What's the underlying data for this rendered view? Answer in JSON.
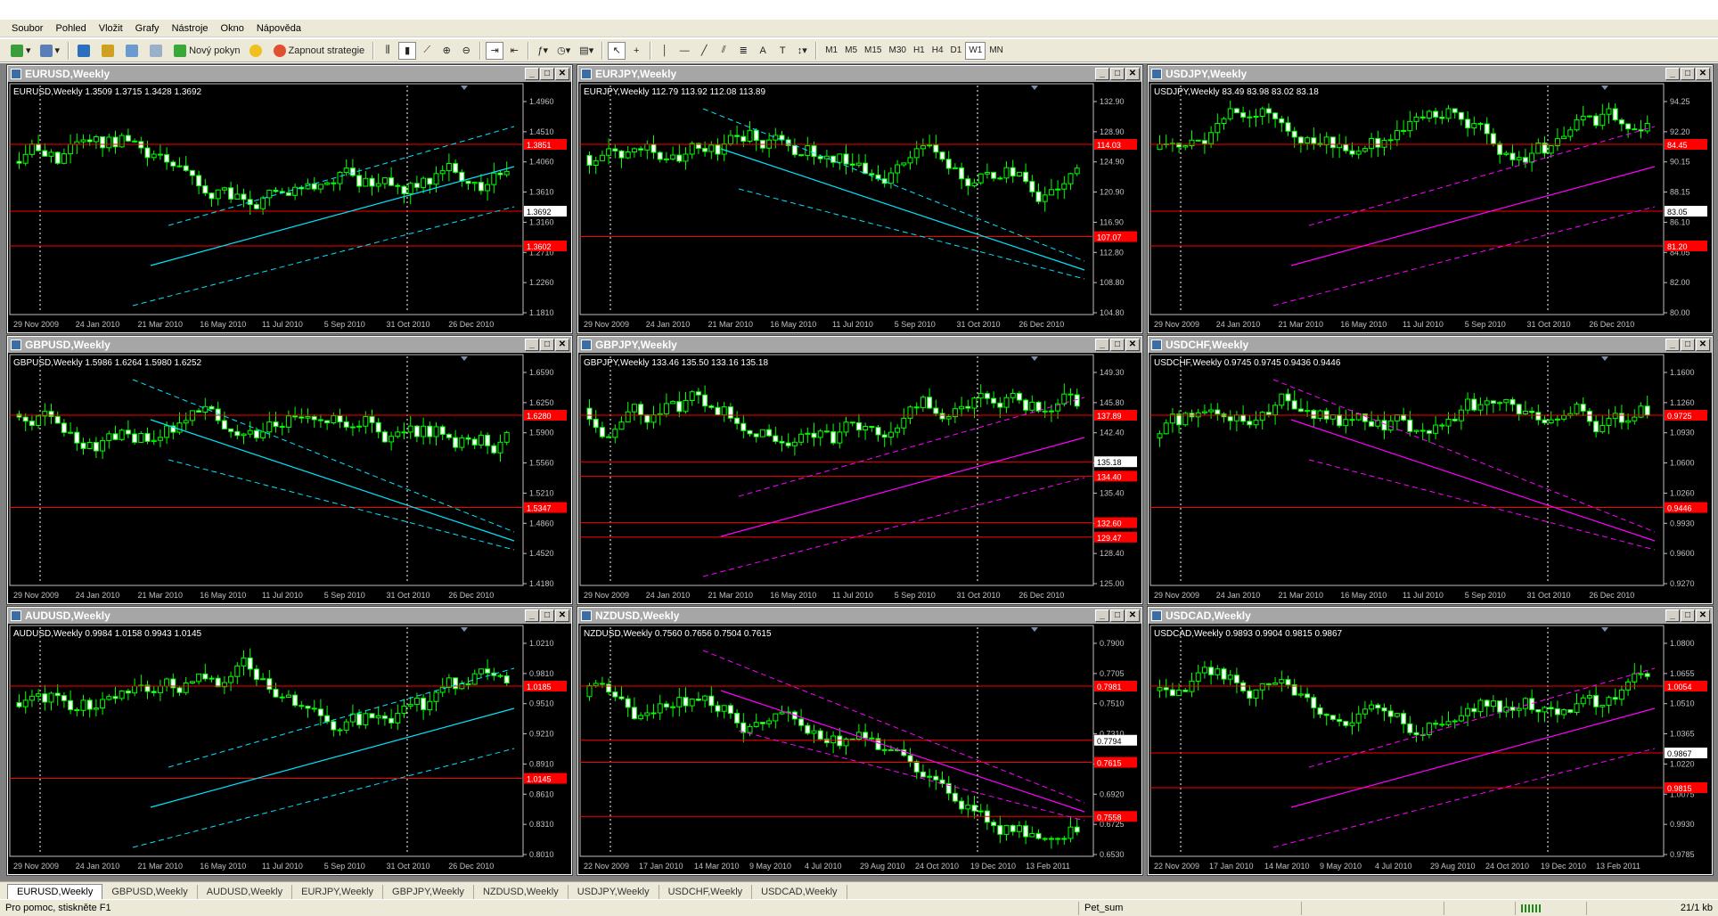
{
  "menu": [
    "Soubor",
    "Pohled",
    "Vložit",
    "Grafy",
    "Nástroje",
    "Okno",
    "Nápověda"
  ],
  "toolbar": {
    "new_order": "Nový pokyn",
    "strategies": "Zapnout strategie",
    "text_tool": "A",
    "timeframes": [
      "M1",
      "M5",
      "M15",
      "M30",
      "H1",
      "H4",
      "D1",
      "W1",
      "MN"
    ],
    "active_timeframe": "W1"
  },
  "colors": {
    "bull": "#00ff00",
    "bear": "#ffffff",
    "line": "#ff0000",
    "channel": "#00e5ff",
    "magenta": "#ff00ff",
    "grid": "#c0c0c0"
  },
  "charts": [
    {
      "id": "eurusd",
      "title": "EURUSD,Weekly",
      "info": "EURUSD,Weekly  1.3509 1.3715 1.3428 1.3692",
      "prices": [
        "1.4960",
        "1.4510",
        "1.4060",
        "1.3610",
        "1.3160",
        "1.2710",
        "1.2260",
        "1.1810"
      ],
      "dates": [
        "29 Nov 2009",
        "24 Jan 2010",
        "21 Mar 2010",
        "16 May 2010",
        "11 Jul 2010",
        "5 Sep 2010",
        "31 Oct 2010",
        "26 Dec 2010"
      ],
      "tags": [
        "1.3851",
        "1.3692",
        "1.3602"
      ],
      "ovl": "cyan"
    },
    {
      "id": "eurjpy",
      "title": "EURJPY,Weekly",
      "info": "EURJPY,Weekly  112.79 113.92 112.08 113.89",
      "prices": [
        "132.90",
        "128.90",
        "124.90",
        "120.90",
        "116.90",
        "112.80",
        "108.80",
        "104.80"
      ],
      "dates": [
        "29 Nov 2009",
        "24 Jan 2010",
        "21 Mar 2010",
        "16 May 2010",
        "11 Jul 2010",
        "5 Sep 2010",
        "31 Oct 2010",
        "26 Dec 2010"
      ],
      "tags": [
        "114.03",
        "107.07"
      ],
      "ovl": "cyan"
    },
    {
      "id": "usdjpy",
      "title": "USDJPY,Weekly",
      "info": "USDJPY,Weekly  83.49 83.98 83.02 83.18",
      "prices": [
        "94.25",
        "92.20",
        "90.15",
        "88.15",
        "86.10",
        "84.05",
        "82.00",
        "80.00"
      ],
      "dates": [
        "29 Nov 2009",
        "24 Jan 2010",
        "21 Mar 2010",
        "16 May 2010",
        "11 Jul 2010",
        "5 Sep 2010",
        "31 Oct 2010",
        "26 Dec 2010"
      ],
      "tags": [
        "84.45",
        "83.05",
        "81.20"
      ],
      "ovl": "magenta"
    },
    {
      "id": "gbpusd",
      "title": "GBPUSD,Weekly",
      "info": "GBPUSD,Weekly  1.5986 1.6264 1.5980 1.6252",
      "prices": [
        "1.6590",
        "1.6250",
        "1.5900",
        "1.5560",
        "1.5210",
        "1.4860",
        "1.4520",
        "1.4180"
      ],
      "dates": [
        "29 Nov 2009",
        "24 Jan 2010",
        "21 Mar 2010",
        "16 May 2010",
        "11 Jul 2010",
        "5 Sep 2010",
        "31 Oct 2010",
        "26 Dec 2010"
      ],
      "tags": [
        "1.6280",
        "1.5347"
      ],
      "ovl": "cyan"
    },
    {
      "id": "gbpjpy",
      "title": "GBPJPY,Weekly",
      "info": "GBPJPY,Weekly  133.46 135.50 133.16 135.18",
      "prices": [
        "149.30",
        "145.80",
        "142.40",
        "138.90",
        "135.40",
        "131.90",
        "128.40",
        "125.00"
      ],
      "dates": [
        "29 Nov 2009",
        "24 Jan 2010",
        "21 Mar 2010",
        "16 May 2010",
        "11 Jul 2010",
        "5 Sep 2010",
        "31 Oct 2010",
        "26 Dec 2010"
      ],
      "tags": [
        "137.89",
        "135.18",
        "134.40",
        "132.60",
        "129.47"
      ],
      "ovl": "magenta"
    },
    {
      "id": "usdchf",
      "title": "USDCHF,Weekly",
      "info": "USDCHF,Weekly  0.9745 0.9745 0.9436 0.9446",
      "prices": [
        "1.1600",
        "1.1260",
        "1.0930",
        "1.0600",
        "1.0260",
        "0.9930",
        "0.9600",
        "0.9270"
      ],
      "dates": [
        "29 Nov 2009",
        "24 Jan 2010",
        "21 Mar 2010",
        "16 May 2010",
        "11 Jul 2010",
        "5 Sep 2010",
        "31 Oct 2010",
        "26 Dec 2010"
      ],
      "tags": [
        "0.9725",
        "0.9446"
      ],
      "ovl": "magenta"
    },
    {
      "id": "audusd",
      "title": "AUDUSD,Weekly",
      "info": "AUDUSD,Weekly  0.9984 1.0158 0.9943 1.0145",
      "prices": [
        "1.0210",
        "0.9810",
        "0.9510",
        "0.9210",
        "0.8910",
        "0.8610",
        "0.8310",
        "0.8010"
      ],
      "dates": [
        "29 Nov 2009",
        "24 Jan 2010",
        "21 Mar 2010",
        "16 May 2010",
        "11 Jul 2010",
        "5 Sep 2010",
        "31 Oct 2010",
        "26 Dec 2010"
      ],
      "tags": [
        "1.0185",
        "1.0145"
      ],
      "ovl": "cyan"
    },
    {
      "id": "nzdusd",
      "title": "NZDUSD,Weekly",
      "info": "NZDUSD,Weekly  0.7560 0.7656 0.7504 0.7615",
      "prices": [
        "0.7900",
        "0.7705",
        "0.7510",
        "0.7310",
        "0.7115",
        "0.6920",
        "0.6725",
        "0.6530"
      ],
      "dates": [
        "22 Nov 2009",
        "17 Jan 2010",
        "14 Mar 2010",
        "9 May 2010",
        "4 Jul 2010",
        "29 Aug 2010",
        "24 Oct 2010",
        "19 Dec 2010",
        "13 Feb 2011"
      ],
      "tags": [
        "0.7981",
        "0.7794",
        "0.7615",
        "0.7558"
      ],
      "ovl": "magenta"
    },
    {
      "id": "usdcad",
      "title": "USDCAD,Weekly",
      "info": "USDCAD,Weekly  0.9893 0.9904 0.9815 0.9867",
      "prices": [
        "1.0800",
        "1.0655",
        "1.0510",
        "1.0365",
        "1.0220",
        "1.0075",
        "0.9930",
        "0.9785"
      ],
      "dates": [
        "22 Nov 2009",
        "17 Jan 2010",
        "14 Mar 2010",
        "9 May 2010",
        "4 Jul 2010",
        "29 Aug 2010",
        "24 Oct 2010",
        "19 Dec 2010",
        "13 Feb 2011"
      ],
      "tags": [
        "1.0054",
        "0.9867",
        "0.9815"
      ],
      "ovl": "magenta"
    }
  ],
  "tabs": [
    "EURUSD,Weekly",
    "GBPUSD,Weekly",
    "AUDUSD,Weekly",
    "EURJPY,Weekly",
    "GBPJPY,Weekly",
    "NZDUSD,Weekly",
    "USDJPY,Weekly",
    "USDCHF,Weekly",
    "USDCAD,Weekly"
  ],
  "status": {
    "help": "Pro pomoc, stiskněte F1",
    "profile": "Pet_sum",
    "traffic": "21/1 kb"
  }
}
